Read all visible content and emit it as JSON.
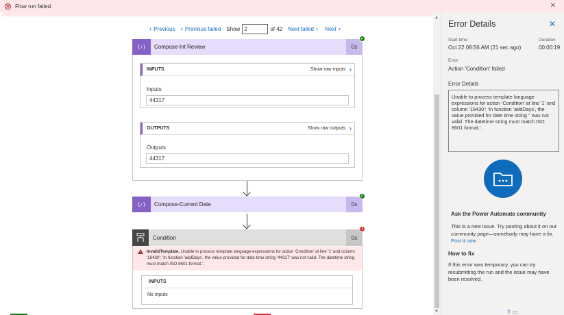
{
  "banner": {
    "message": "Flow run failed.",
    "close": "✕"
  },
  "nav": {
    "previous": "Previous",
    "previous_failed": "Previous failed",
    "show_label": "Show",
    "page_value": "2",
    "of_total": "of 42",
    "next_failed": "Next failed",
    "next": "Next"
  },
  "steps": {
    "compose_int": {
      "title": "Compose-Int Review",
      "icon": "{/}",
      "duration": "0s",
      "status_icon": "✓",
      "inputs": {
        "label": "INPUTS",
        "raw": "Show raw inputs",
        "field_label": "Inputs",
        "field_value": "44317"
      },
      "outputs": {
        "label": "OUTPUTS",
        "raw": "Show raw outputs",
        "field_label": "Outputs",
        "field_value": "44317"
      }
    },
    "compose_date": {
      "title": "Compose-Current Date",
      "icon": "{/}",
      "duration": "0s",
      "status_icon": "✓"
    },
    "condition": {
      "title": "Condition",
      "duration": "0s",
      "status_icon": "!",
      "error_code": "InvalidTemplate.",
      "error_text": "Unable to process template language expressions for action 'Condition' at line '1' and column '16430': 'In function 'addDays', the value provided for date time string '44317' was not valid. The datetime string must match ISO 8601 format.'.",
      "inputs_label": "INPUTS",
      "no_inputs": "No inputs"
    }
  },
  "side": {
    "title": "Error Details",
    "close": "✕",
    "start_time_label": "Start time",
    "start_time": "Oct 22 08:56 AM (21 sec ago)",
    "duration_label": "Duration",
    "duration": "00:00:19",
    "error_label": "Error",
    "error_value": "Action 'Condition' failed",
    "details_heading": "Error Details",
    "details_text": "Unable to process template language expressions for action 'Condition' at line '1' and column '16430': 'In function 'addDays', the value provided for date time string '' was not valid. The datetime string must match ISO 8601 format.'.",
    "community_heading": "Ask the Power Automate community",
    "community_text": "This is a new issue. Try posting about it on our community page—somebody may have a fix.",
    "community_link": "Post it now",
    "fix_heading": "How to fix",
    "fix_text": "If this error was temporary, you can try resubmitting the run and the issue may have been resolved."
  },
  "colors": {
    "accent": "#0f6cbd",
    "compose": "#8661c5",
    "error": "#d13438",
    "success": "#107c10",
    "banner": "#fde7e9"
  }
}
